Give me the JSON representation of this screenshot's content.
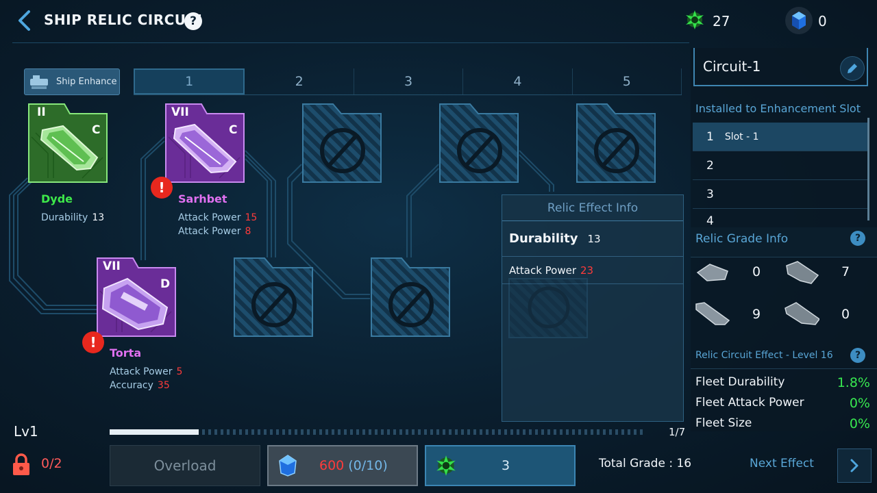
{
  "header": {
    "title": "SHIP RELIC CIRCUIT",
    "help": "?",
    "currency_green": "27",
    "currency_blue": "0"
  },
  "tabs": {
    "ship_enhance": "Ship Enhance",
    "items": [
      "1",
      "2",
      "3",
      "4",
      "5"
    ],
    "active_index": 0
  },
  "relics": [
    {
      "grade": "II",
      "class": "C",
      "name": "Dyde",
      "color": "#3ee84a",
      "stats": [
        {
          "label": "Durability",
          "value": "13",
          "value_color": "#f2f6fa"
        }
      ]
    },
    {
      "grade": "VII",
      "class": "C",
      "name": "Sarhbet",
      "color": "#e070f0",
      "stats": [
        {
          "label": "Attack Power",
          "value": "15",
          "value_color": "#ff3b3b"
        },
        {
          "label": "Attack Power",
          "value": "8",
          "value_color": "#ff3b3b"
        }
      ]
    },
    {
      "grade": "VII",
      "class": "D",
      "name": "Torta",
      "color": "#e070f0",
      "stats": [
        {
          "label": "Attack Power",
          "value": "5",
          "value_color": "#ff3b3b"
        },
        {
          "label": "Accuracy",
          "value": "35",
          "value_color": "#ff3b3b"
        }
      ]
    }
  ],
  "effect_info": {
    "title": "Relic Effect Info",
    "rows": [
      {
        "label": "Durability",
        "value": "13"
      },
      {
        "label": "Attack Power",
        "value": "23"
      }
    ]
  },
  "sidebar": {
    "circuit_name": "Circuit-1",
    "installed_label": "Installed to Enhancement Slot",
    "slots": [
      {
        "num": "1",
        "name": "Slot - 1"
      },
      {
        "num": "2",
        "name": ""
      },
      {
        "num": "3",
        "name": ""
      },
      {
        "num": "4",
        "name": ""
      }
    ],
    "grade_info_label": "Relic Grade Info",
    "grade_counts": [
      "0",
      "7",
      "9",
      "0"
    ],
    "circuit_effect_label": "Relic Circuit Effect - Level 16",
    "fleet_effects": [
      {
        "label": "Fleet Durability",
        "value": "1.8%"
      },
      {
        "label": "Fleet Attack Power",
        "value": "0%"
      },
      {
        "label": "Fleet Size",
        "value": "0%"
      }
    ]
  },
  "bottom": {
    "level": "Lv1",
    "progress_text": "1/7",
    "progress_fraction": 0.167,
    "lock_count": "0/2",
    "overload_label": "Overload",
    "cost_red": "600",
    "cost_blue": "(0/10)",
    "core_count": "3",
    "total_grade": "Total Grade : 16",
    "next_effect": "Next Effect"
  },
  "colors": {
    "accent": "#59a6d6",
    "green_value": "#38e850",
    "red_value": "#ff3b3b",
    "purple_relic": "#6a2d98",
    "green_relic": "#2e6b2a"
  }
}
